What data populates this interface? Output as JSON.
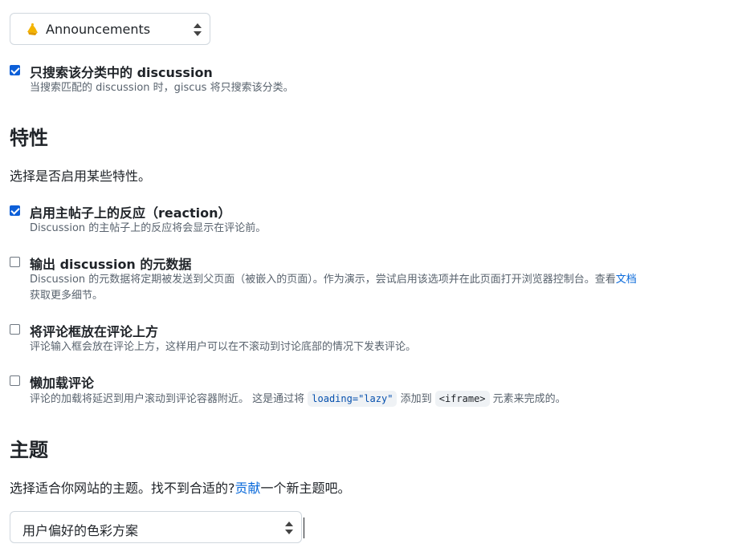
{
  "category_select": {
    "icon": "megaphone-icon",
    "value": "Announcements"
  },
  "search_in_category": {
    "checked": true,
    "title": "只搜索该分类中的 discussion",
    "desc": "当搜索匹配的 discussion 时，giscus 将只搜索该分类。"
  },
  "features": {
    "heading": "特性",
    "intro": "选择是否启用某些特性。",
    "reactions": {
      "checked": true,
      "title": "启用主帖子上的反应（reaction）",
      "desc": "Discussion 的主帖子上的反应将会显示在评论前。"
    },
    "metadata": {
      "checked": false,
      "title": "输出 discussion 的元数据",
      "desc_part1": "Discussion 的元数据将定期被发送到父页面（被嵌入的页面）。作为演示，尝试启用该选项并在此页面打开浏览器控制台。查看",
      "desc_link": "文档",
      "desc_part2": "获取更多细节。"
    },
    "input_top": {
      "checked": false,
      "title": "将评论框放在评论上方",
      "desc": "评论输入框会放在评论上方，这样用户可以在不滚动到讨论底部的情况下发表评论。"
    },
    "lazy": {
      "checked": false,
      "title": "懒加载评论",
      "desc_part1": "评论的加载将延迟到用户滚动到评论容器附近。 这是通过将",
      "code1": "loading=\"lazy\"",
      "desc_part2": "添加到",
      "code2": "<iframe>",
      "desc_part3": "元素来完成的。"
    }
  },
  "theme": {
    "heading": "主题",
    "intro_part1": "选择适合你网站的主题。找不到合适的?",
    "intro_link": "贡献",
    "intro_part2": "一个新主题吧。",
    "select_value": "用户偏好的色彩方案"
  },
  "colors": {
    "accent": "#0969da",
    "checkbox": "#0d5fd8",
    "megaphone": "#f4b400"
  }
}
